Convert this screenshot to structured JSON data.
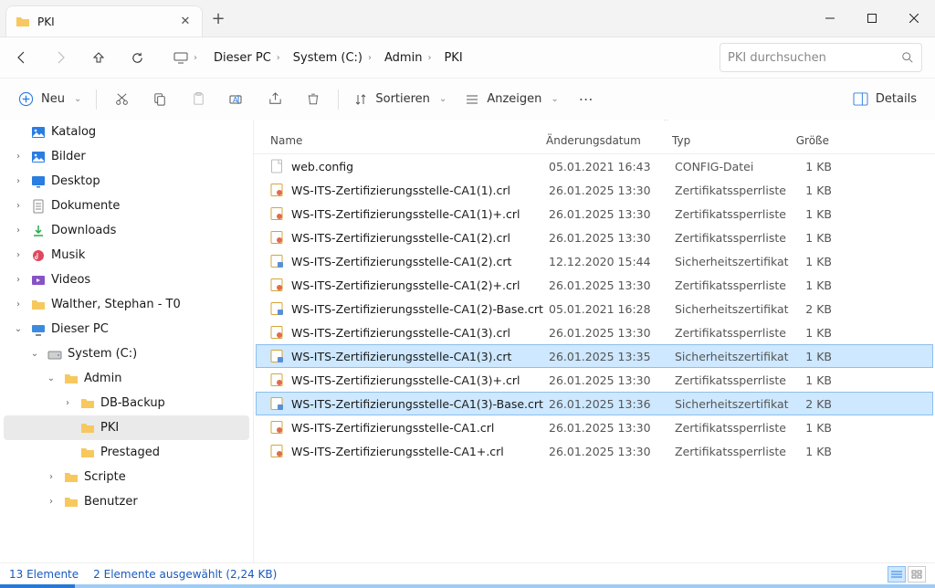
{
  "window": {
    "tab_title": "PKI"
  },
  "breadcrumb": [
    "Dieser PC",
    "System (C:)",
    "Admin",
    "PKI"
  ],
  "search": {
    "placeholder": "PKI durchsuchen"
  },
  "toolbar": {
    "new": "Neu",
    "sort": "Sortieren",
    "view": "Anzeigen",
    "details": "Details"
  },
  "tree": [
    {
      "depth": 0,
      "caret": "",
      "icon": "image",
      "label": "Katalog"
    },
    {
      "depth": 0,
      "caret": ">",
      "icon": "image",
      "label": "Bilder"
    },
    {
      "depth": 0,
      "caret": ">",
      "icon": "desktop",
      "label": "Desktop"
    },
    {
      "depth": 0,
      "caret": ">",
      "icon": "doc",
      "label": "Dokumente"
    },
    {
      "depth": 0,
      "caret": ">",
      "icon": "download",
      "label": "Downloads"
    },
    {
      "depth": 0,
      "caret": ">",
      "icon": "music",
      "label": "Musik"
    },
    {
      "depth": 0,
      "caret": ">",
      "icon": "video",
      "label": "Videos"
    },
    {
      "depth": 0,
      "caret": ">",
      "icon": "folder",
      "label": "Walther, Stephan - T0"
    },
    {
      "depth": 0,
      "caret": "v",
      "icon": "pc",
      "label": "Dieser PC"
    },
    {
      "depth": 1,
      "caret": "v",
      "icon": "drive",
      "label": "System (C:)"
    },
    {
      "depth": 2,
      "caret": "v",
      "icon": "folder",
      "label": "Admin"
    },
    {
      "depth": 3,
      "caret": ">",
      "icon": "folder",
      "label": "DB-Backup"
    },
    {
      "depth": 3,
      "caret": "",
      "icon": "folder",
      "label": "PKI",
      "active": true
    },
    {
      "depth": 3,
      "caret": "",
      "icon": "folder",
      "label": "Prestaged"
    },
    {
      "depth": 2,
      "caret": ">",
      "icon": "folder",
      "label": "Scripte"
    },
    {
      "depth": 2,
      "caret": ">",
      "icon": "folder",
      "label": "Benutzer"
    }
  ],
  "columns": {
    "name": "Name",
    "date": "Änderungsdatum",
    "type": "Typ",
    "size": "Größe"
  },
  "files": [
    {
      "icon": "config",
      "name": "web.config",
      "date": "05.01.2021 16:43",
      "type": "CONFIG-Datei",
      "size": "1 KB",
      "sel": false
    },
    {
      "icon": "crl",
      "name": "WS-ITS-Zertifizierungsstelle-CA1(1).crl",
      "date": "26.01.2025 13:30",
      "type": "Zertifikatssperrliste",
      "size": "1 KB",
      "sel": false
    },
    {
      "icon": "crl",
      "name": "WS-ITS-Zertifizierungsstelle-CA1(1)+.crl",
      "date": "26.01.2025 13:30",
      "type": "Zertifikatssperrliste",
      "size": "1 KB",
      "sel": false
    },
    {
      "icon": "crl",
      "name": "WS-ITS-Zertifizierungsstelle-CA1(2).crl",
      "date": "26.01.2025 13:30",
      "type": "Zertifikatssperrliste",
      "size": "1 KB",
      "sel": false
    },
    {
      "icon": "crt",
      "name": "WS-ITS-Zertifizierungsstelle-CA1(2).crt",
      "date": "12.12.2020 15:44",
      "type": "Sicherheitszertifikat",
      "size": "1 KB",
      "sel": false
    },
    {
      "icon": "crl",
      "name": "WS-ITS-Zertifizierungsstelle-CA1(2)+.crl",
      "date": "26.01.2025 13:30",
      "type": "Zertifikatssperrliste",
      "size": "1 KB",
      "sel": false
    },
    {
      "icon": "crt",
      "name": "WS-ITS-Zertifizierungsstelle-CA1(2)-Base.crt",
      "date": "05.01.2021 16:28",
      "type": "Sicherheitszertifikat",
      "size": "2 KB",
      "sel": false
    },
    {
      "icon": "crl",
      "name": "WS-ITS-Zertifizierungsstelle-CA1(3).crl",
      "date": "26.01.2025 13:30",
      "type": "Zertifikatssperrliste",
      "size": "1 KB",
      "sel": false
    },
    {
      "icon": "crt",
      "name": "WS-ITS-Zertifizierungsstelle-CA1(3).crt",
      "date": "26.01.2025 13:35",
      "type": "Sicherheitszertifikat",
      "size": "1 KB",
      "sel": true
    },
    {
      "icon": "crl",
      "name": "WS-ITS-Zertifizierungsstelle-CA1(3)+.crl",
      "date": "26.01.2025 13:30",
      "type": "Zertifikatssperrliste",
      "size": "1 KB",
      "sel": false
    },
    {
      "icon": "crt",
      "name": "WS-ITS-Zertifizierungsstelle-CA1(3)-Base.crt",
      "date": "26.01.2025 13:36",
      "type": "Sicherheitszertifikat",
      "size": "2 KB",
      "sel": true
    },
    {
      "icon": "crl",
      "name": "WS-ITS-Zertifizierungsstelle-CA1.crl",
      "date": "26.01.2025 13:30",
      "type": "Zertifikatssperrliste",
      "size": "1 KB",
      "sel": false
    },
    {
      "icon": "crl",
      "name": "WS-ITS-Zertifizierungsstelle-CA1+.crl",
      "date": "26.01.2025 13:30",
      "type": "Zertifikatssperrliste",
      "size": "1 KB",
      "sel": false
    }
  ],
  "status": {
    "count": "13 Elemente",
    "selection": "2 Elemente ausgewählt (2,24 KB)"
  }
}
